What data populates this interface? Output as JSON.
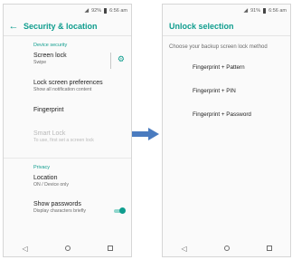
{
  "left_screen": {
    "status": {
      "battery": "92%",
      "time": "6:56 am"
    },
    "title": "Security & location",
    "back_icon": "arrow-back-icon",
    "sections": [
      {
        "header": "Device security",
        "items": [
          {
            "title": "Screen lock",
            "subtitle": "Swipe",
            "icon": "gear-icon"
          },
          {
            "title": "Lock screen preferences",
            "subtitle": "Show all notification content"
          },
          {
            "title": "Fingerprint",
            "subtitle": ""
          },
          {
            "title": "Smart Lock",
            "subtitle": "To use, first set a screen lock",
            "disabled": true
          }
        ]
      },
      {
        "header": "Privacy",
        "items": [
          {
            "title": "Location",
            "subtitle": "ON / Device only"
          },
          {
            "title": "Show passwords",
            "subtitle": "Display characters briefly",
            "toggle": true
          }
        ]
      }
    ]
  },
  "right_screen": {
    "status": {
      "battery": "91%",
      "time": "6:56 am"
    },
    "title": "Unlock selection",
    "prompt": "Choose your backup screen lock method",
    "options": [
      "Fingerprint + Pattern",
      "Fingerprint + PIN",
      "Fingerprint + Password"
    ]
  },
  "colors": {
    "accent": "#0f9d8e",
    "arrow": "#4a7bbf"
  }
}
